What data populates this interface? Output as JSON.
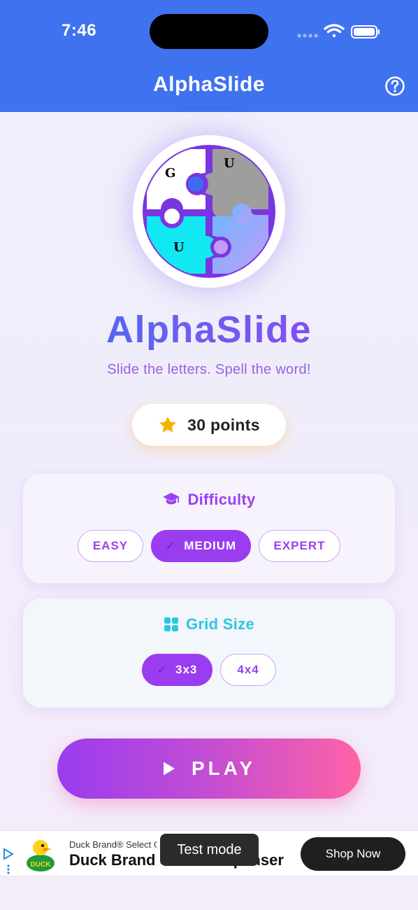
{
  "status_bar": {
    "time": "7:46"
  },
  "nav": {
    "title": "AlphaSlide",
    "help_icon": "question-circle-icon"
  },
  "hero": {
    "logo_letters": [
      "G",
      "U",
      "U"
    ],
    "title": "AlphaSlide",
    "tagline": "Slide the letters. Spell the word!"
  },
  "points": {
    "icon": "star-icon",
    "text": "30 points"
  },
  "difficulty": {
    "heading": "Difficulty",
    "icon": "graduation-cap-icon",
    "options": [
      {
        "label": "EASY",
        "selected": false
      },
      {
        "label": "MEDIUM",
        "selected": true
      },
      {
        "label": "EXPERT",
        "selected": false
      }
    ]
  },
  "grid_size": {
    "heading": "Grid Size",
    "icon": "grid-icon",
    "options": [
      {
        "label": "3x3",
        "selected": true
      },
      {
        "label": "4x4",
        "selected": false
      }
    ]
  },
  "play_button": {
    "label": "PLAY",
    "icon": "play-icon"
  },
  "ad": {
    "sub_text": "Duck Brand® Select G",
    "headline": "Duck Brand Select Dispenser",
    "cta": "Shop Now",
    "logo_text": "DUCK"
  },
  "toast": {
    "text": "Test mode"
  },
  "colors": {
    "nav_bar": "#3f72ee",
    "accent_purple": "#9a3cf0",
    "accent_cyan": "#2cc6e0",
    "play_gradient_end": "#ff63a5",
    "star": "#f5b400"
  }
}
